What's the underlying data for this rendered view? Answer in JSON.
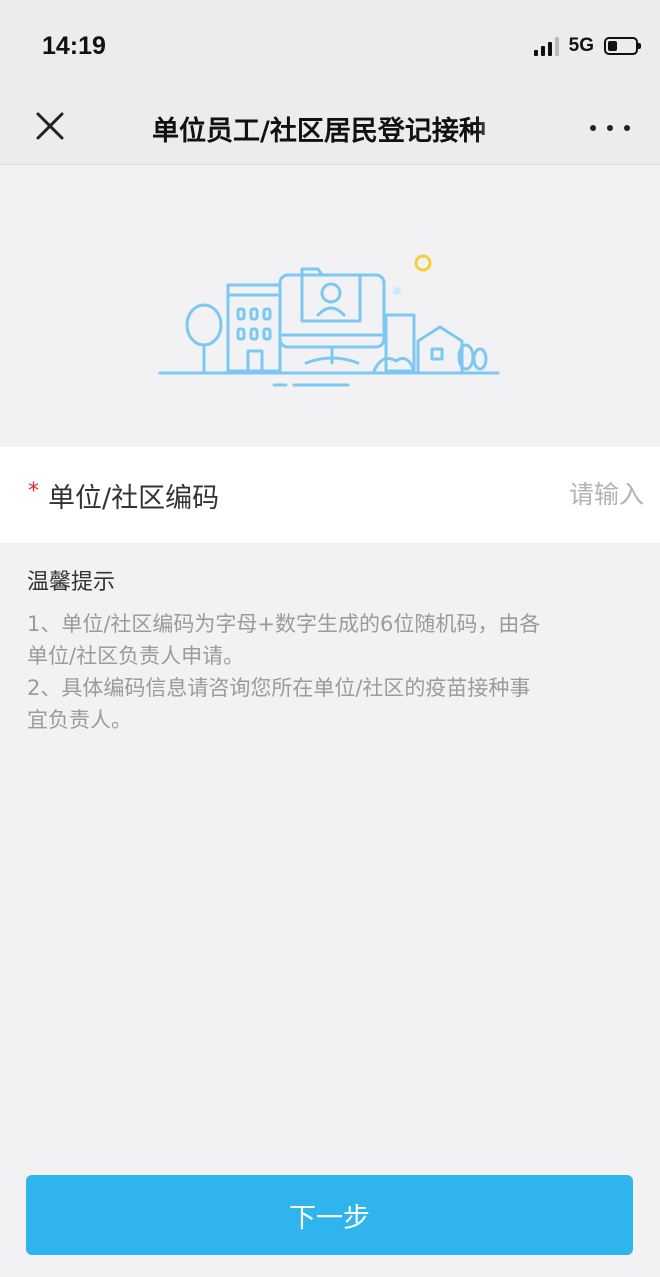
{
  "status_bar": {
    "time": "14:19",
    "network": "5G",
    "battery_level_fraction": 0.35
  },
  "nav": {
    "title": "单位员工/社区居民登记接种",
    "close_icon": "close-icon",
    "more_icon": "more-icon"
  },
  "hero": {
    "illustration": "building-community-illustration",
    "accent_color": "#7cc8f2",
    "sun_color": "#f2d232"
  },
  "form": {
    "required_mark": "*",
    "code_label": "单位/社区编码",
    "code_placeholder": "请输入",
    "code_value": ""
  },
  "tips": {
    "title": "温馨提示",
    "lines": [
      "1、单位/社区编码为字母+数字生成的6位随机码，由各",
      "单位/社区负责人申请。",
      "2、具体编码信息请咨询您所在单位/社区的疫苗接种事",
      "宜负责人。"
    ]
  },
  "footer": {
    "next_label": "下一步",
    "button_color": "#2fb4ee"
  }
}
